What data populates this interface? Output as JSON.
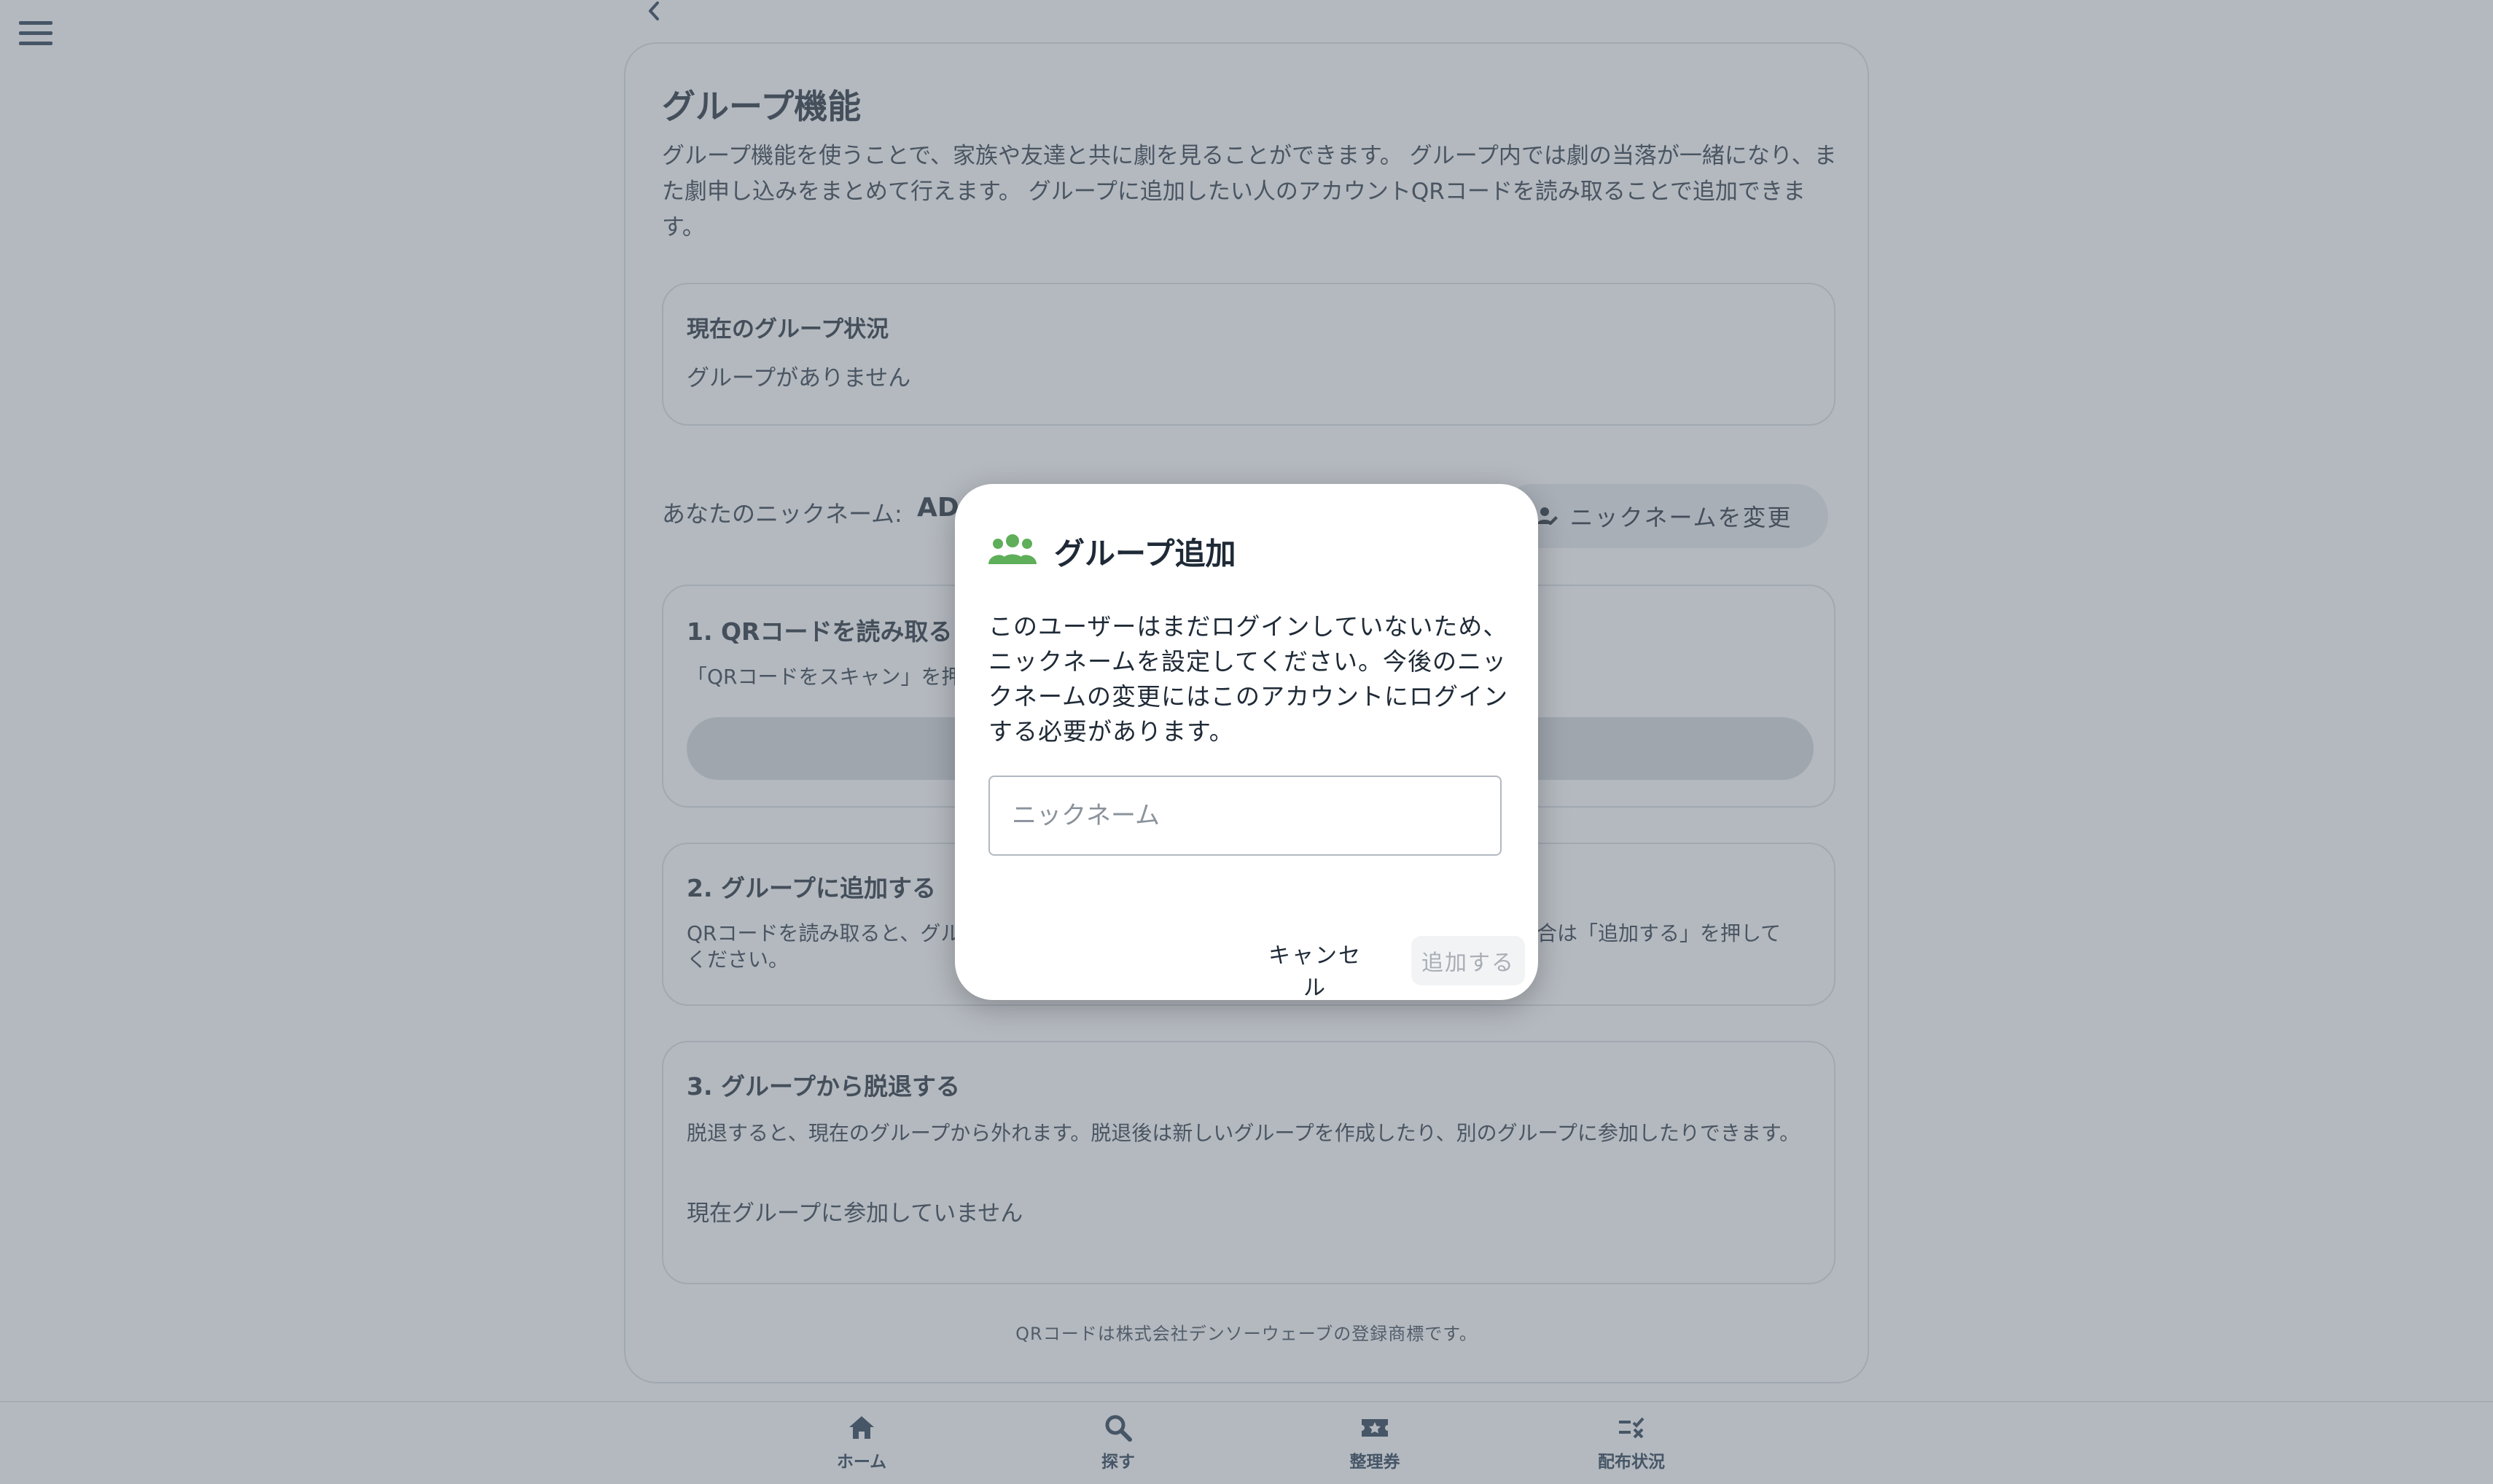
{
  "page": {
    "title": "グループ機能",
    "description": "グループ機能を使うことで、家族や友達と共に劇を見ることができます。 グループ内では劇の当落が一緒になり、また劇申し込みをまとめて行えます。 グループに追加したい人のアカウントQRコードを読み取ることで追加できます。"
  },
  "status_box": {
    "title": "現在のグループ状況",
    "text": "グループがありません"
  },
  "nickname": {
    "label": "あなたのニックネーム:",
    "value": "AD",
    "change_button": "ニックネームを変更"
  },
  "step1": {
    "title": "1. QRコードを読み取る",
    "text": "「QRコードをスキャン」を押"
  },
  "step2": {
    "title": "2. グループに追加する",
    "text_left": "QRコードを読み取ると、グル",
    "text_right": "場合は「追加する」を押して",
    "text_line2": "ください。"
  },
  "step3": {
    "title": "3. グループから脱退する",
    "text": "脱退すると、現在のグループから外れます。脱退後は新しいグループを作成したり、別のグループに参加したりできます。",
    "status": "現在グループに参加していません"
  },
  "footer_note": "QRコードは株式会社デンソーウェーブの登録商標です。",
  "bottom_nav": [
    {
      "label": "ホーム",
      "icon": "home-icon"
    },
    {
      "label": "探す",
      "icon": "search-icon"
    },
    {
      "label": "整理券",
      "icon": "ticket-icon"
    },
    {
      "label": "配布状況",
      "icon": "checklist-icon"
    }
  ],
  "dialog": {
    "title": "グループ追加",
    "icon": "group-icon",
    "icon_color": "#5fae5a",
    "message": "このユーザーはまだログインしていないため、ニックネームを設定してください。今後のニックネームの変更にはこのアカウントにログインする必要があります。",
    "input_value": "",
    "input_placeholder": "ニックネーム",
    "cancel_label": "キャンセル",
    "add_label": "追加する"
  }
}
